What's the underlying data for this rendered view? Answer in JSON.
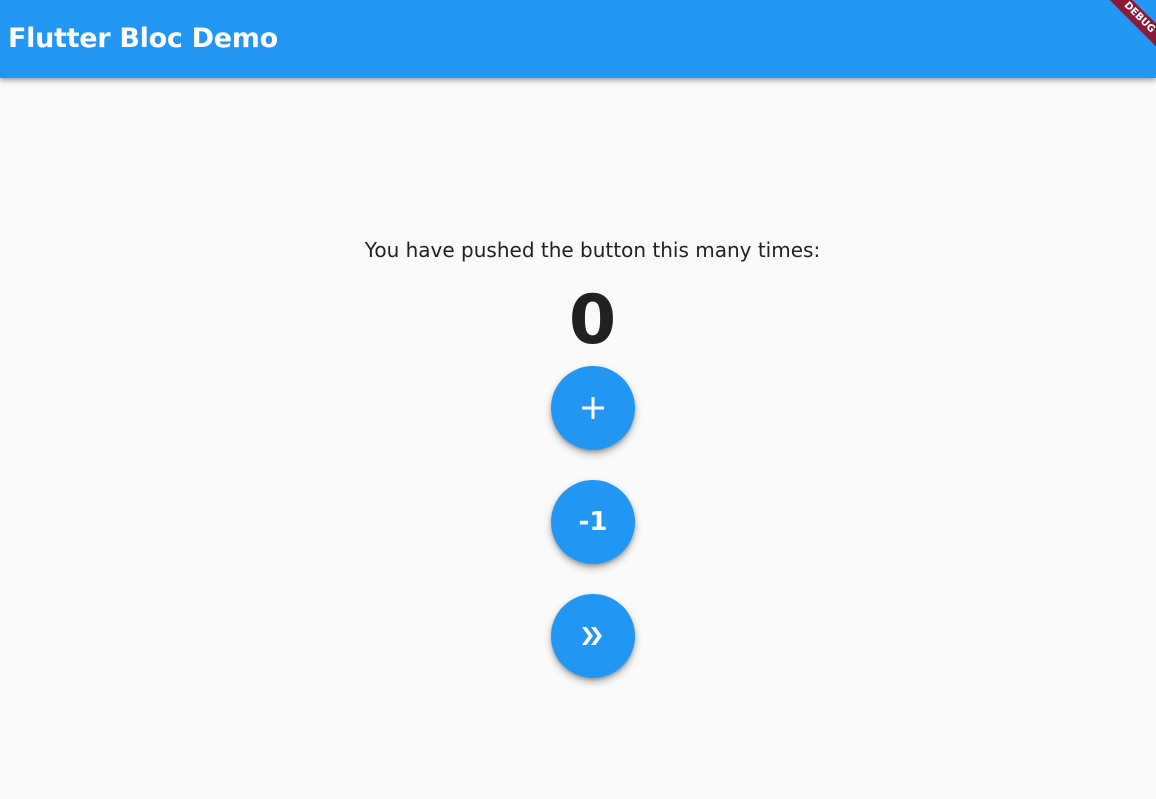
{
  "app_bar": {
    "title": "Flutter Bloc Demo",
    "color": "#2196f3"
  },
  "debug_banner": {
    "label": "DEBUG",
    "color": "#8b1a3a"
  },
  "counter": {
    "label": "You have pushed the button this many times:",
    "value": "0"
  },
  "buttons": {
    "increment": {
      "icon": "add-icon"
    },
    "decrement": {
      "label": "-1"
    },
    "skip": {
      "icon": "double-chevron-right-icon"
    }
  }
}
